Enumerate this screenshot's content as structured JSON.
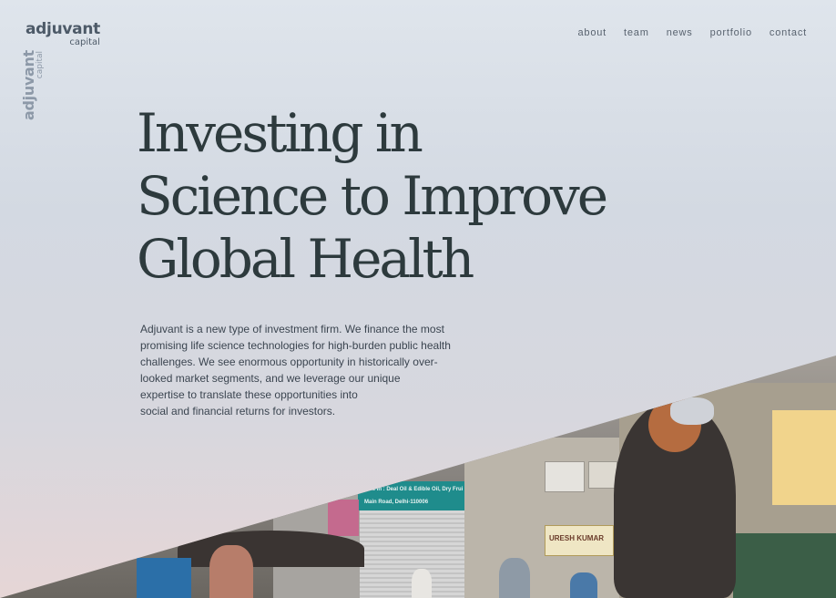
{
  "logo": {
    "main": "adjuvant",
    "sub": "capital"
  },
  "nav": {
    "items": [
      "about",
      "team",
      "news",
      "portfolio",
      "contact"
    ]
  },
  "hero": {
    "headline_lines": [
      "Investing in",
      "Science to Improve",
      "Global Health"
    ],
    "intro_lines": [
      "Adjuvant is a new type of investment firm. We finance the most",
      "promising life science technologies for high-burden public health",
      "challenges. We see enormous opportunity in historically over-",
      "looked market segments, and we leverage our unique",
      "expertise to translate these opportunities into",
      "social and financial returns for investors."
    ]
  },
  "photo": {
    "signs": {
      "shop": "URESH KUMAR",
      "teal": "Deals in : Deal Oil & Edible Oil, Dry Fruits",
      "teal_address": "Main Road, Delhi-110006"
    }
  },
  "colors": {
    "headline": "#2d3a3d",
    "body_text": "#3b4550",
    "nav_text": "#59636f",
    "logo": "#4d5a68",
    "background_top": "#dfe5ec",
    "background_bottom": "#e6d6d6"
  }
}
